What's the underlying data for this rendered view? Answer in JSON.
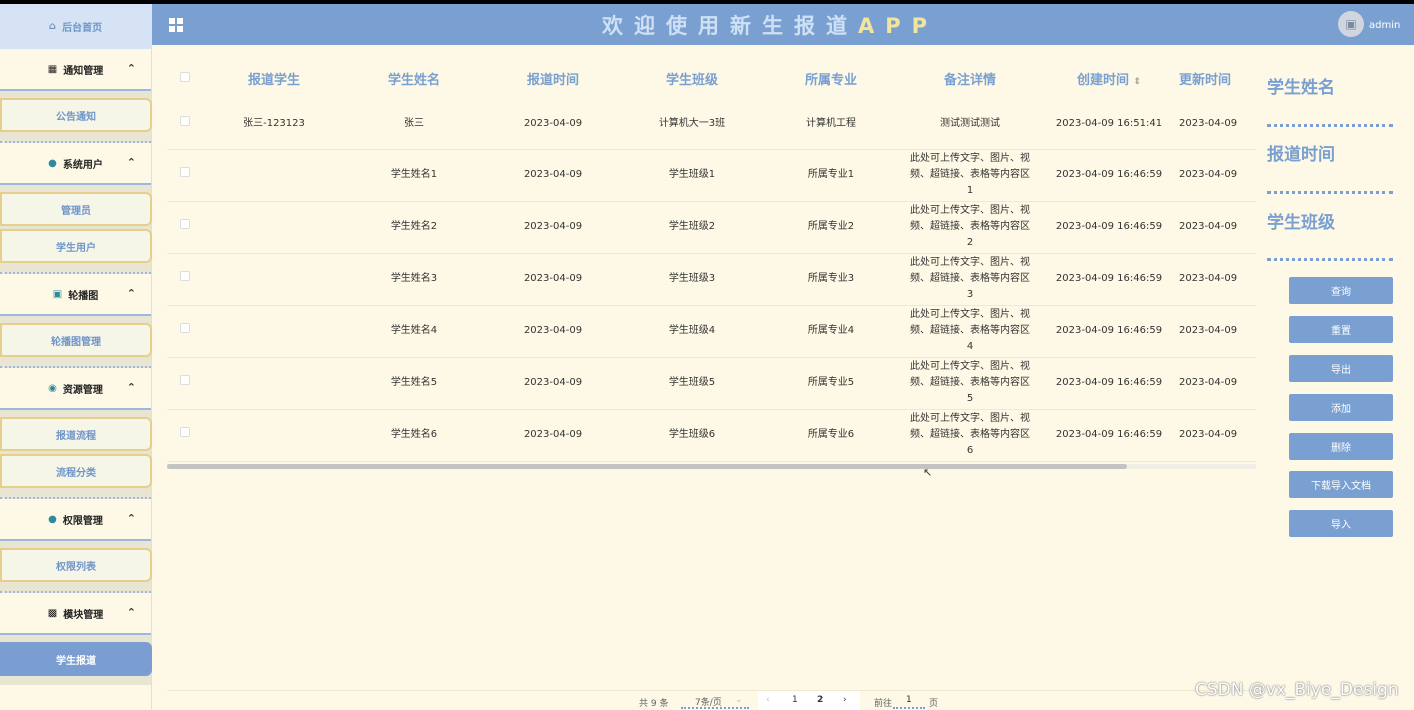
{
  "app": {
    "title_part1": "欢迎使用新生报道",
    "title_part2": "APP",
    "user": "admin"
  },
  "sidebar": {
    "home": "后台首页",
    "groups": [
      {
        "label": "通知管理",
        "items": [
          "公告通知"
        ]
      },
      {
        "label": "系统用户",
        "items": [
          "管理员",
          "学生用户"
        ]
      },
      {
        "label": "轮播图",
        "items": [
          "轮播图管理"
        ]
      },
      {
        "label": "资源管理",
        "items": [
          "报道流程",
          "流程分类"
        ]
      },
      {
        "label": "权限管理",
        "items": [
          "权限列表"
        ]
      },
      {
        "label": "模块管理",
        "items": [
          "学生报道"
        ]
      }
    ],
    "active_item": "学生报道"
  },
  "table": {
    "headers": [
      "报道学生",
      "学生姓名",
      "报道时间",
      "学生班级",
      "所属专业",
      "备注详情",
      "创建时间",
      "更新时间"
    ],
    "rows": [
      [
        "张三-123123",
        "张三",
        "2023-04-09",
        "计算机大一3班",
        "计算机工程",
        "测试测试测试",
        "2023-04-09 16:51:41",
        "2023-04-09"
      ],
      [
        "",
        "学生姓名1",
        "2023-04-09",
        "学生班级1",
        "所属专业1",
        "此处可上传文字、图片、视频、超链接、表格等内容区1",
        "2023-04-09 16:46:59",
        "2023-04-09"
      ],
      [
        "",
        "学生姓名2",
        "2023-04-09",
        "学生班级2",
        "所属专业2",
        "此处可上传文字、图片、视频、超链接、表格等内容区2",
        "2023-04-09 16:46:59",
        "2023-04-09"
      ],
      [
        "",
        "学生姓名3",
        "2023-04-09",
        "学生班级3",
        "所属专业3",
        "此处可上传文字、图片、视频、超链接、表格等内容区3",
        "2023-04-09 16:46:59",
        "2023-04-09"
      ],
      [
        "",
        "学生姓名4",
        "2023-04-09",
        "学生班级4",
        "所属专业4",
        "此处可上传文字、图片、视频、超链接、表格等内容区4",
        "2023-04-09 16:46:59",
        "2023-04-09"
      ],
      [
        "",
        "学生姓名5",
        "2023-04-09",
        "学生班级5",
        "所属专业5",
        "此处可上传文字、图片、视频、超链接、表格等内容区5",
        "2023-04-09 16:46:59",
        "2023-04-09"
      ],
      [
        "",
        "学生姓名6",
        "2023-04-09",
        "学生班级6",
        "所属专业6",
        "此处可上传文字、图片、视频、超链接、表格等内容区6",
        "2023-04-09 16:46:59",
        "2023-04-09"
      ]
    ]
  },
  "search": {
    "labels": [
      "学生姓名",
      "报道时间",
      "学生班级"
    ],
    "buttons": [
      "查询",
      "重置",
      "导出",
      "添加",
      "删除",
      "下载导入文档",
      "导入"
    ]
  },
  "pagination": {
    "total": "共 9 条",
    "page_size": "7条/页",
    "pages": [
      "1",
      "2"
    ],
    "current_page": "2",
    "goto_label": "前往",
    "goto_value": "1",
    "page_unit": "页"
  },
  "watermark": "CSDN @vx_Biye_Design",
  "colors": {
    "accent": "#7aa0d1",
    "background": "#fdf9e6",
    "title_highlight": "#f3e59c"
  }
}
